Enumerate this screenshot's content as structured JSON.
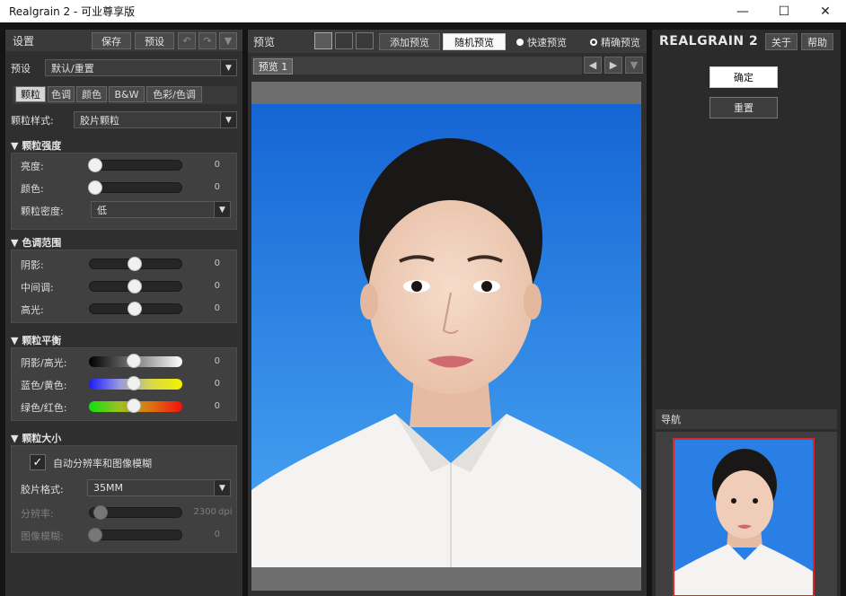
{
  "window": {
    "title": "Realgrain 2 - 可业尊享版"
  },
  "left": {
    "title": "设置",
    "save_label": "保存",
    "preset_label": "预设",
    "preset_row_label": "预设",
    "preset_value": "默认/重置",
    "tabs": [
      {
        "label": "颗粒"
      },
      {
        "label": "色调"
      },
      {
        "label": "颜色"
      },
      {
        "label": "B&W"
      },
      {
        "label": "色彩/色调"
      }
    ],
    "grain_style_label": "颗粒样式:",
    "grain_style_value": "胶片颗粒",
    "sections": {
      "strength": {
        "title": "颗粒强度",
        "rows": [
          {
            "label": "亮度:",
            "value": "0"
          },
          {
            "label": "颜色:",
            "value": "0"
          }
        ],
        "density_label": "颗粒密度:",
        "density_value": "低"
      },
      "tone_range": {
        "title": "色调范围",
        "rows": [
          {
            "label": "阴影:",
            "value": "0"
          },
          {
            "label": "中间调:",
            "value": "0"
          },
          {
            "label": "高光:",
            "value": "0"
          }
        ]
      },
      "balance": {
        "title": "颗粒平衡",
        "rows": [
          {
            "label": "阴影/高光:",
            "value": "0"
          },
          {
            "label": "蓝色/黄色:",
            "value": "0"
          },
          {
            "label": "绿色/红色:",
            "value": "0"
          }
        ]
      },
      "size": {
        "title": "颗粒大小",
        "auto_label": "自动分辨率和图像模糊",
        "auto_checked": true,
        "film_format_label": "胶片格式:",
        "film_format_value": "35MM",
        "resolution_label": "分辨率:",
        "resolution_value": "2300",
        "resolution_unit": "dpi",
        "blur_label": "图像模糊:",
        "blur_value": "0"
      }
    }
  },
  "center": {
    "title": "预览",
    "add_preview_label": "添加预览",
    "random_preview_label": "随机预览",
    "fast_preview_label": "快速预览",
    "accurate_preview_label": "精确预览",
    "preview_tab_label": "预览 1"
  },
  "right": {
    "logo": "REALGRAIN 2",
    "about_label": "关于",
    "help_label": "帮助",
    "ok_label": "确定",
    "reset_label": "重置",
    "navigator_label": "导航"
  },
  "colors": {
    "accent_red": "#d42a2a",
    "photo_blue": "#1a6fd6"
  }
}
